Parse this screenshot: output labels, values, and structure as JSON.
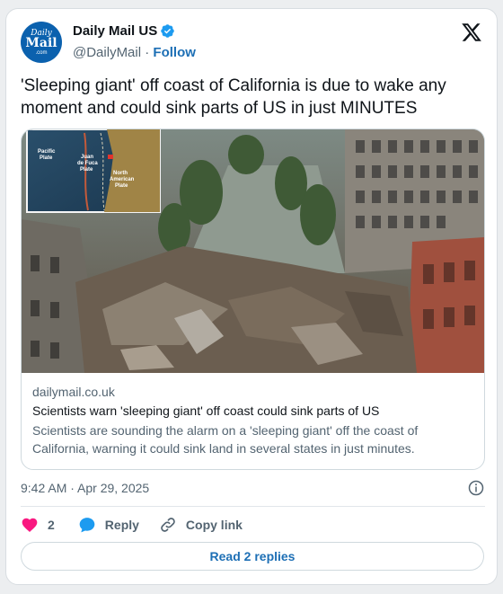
{
  "author": {
    "avatar": {
      "line1": "Daily",
      "line2": "Mail",
      "line3": ".com"
    },
    "name": "Daily Mail US",
    "handle": "@DailyMail",
    "separator": "·",
    "follow_label": "Follow"
  },
  "tweet": {
    "text": "'Sleeping giant' off coast of California is due to wake any moment and could sink parts of US in just MINUTES"
  },
  "card": {
    "inset_map_labels": {
      "pacific": [
        "Pacific",
        "Plate"
      ],
      "juan": [
        "Juan",
        "de Fuca",
        "Plate"
      ],
      "north_american": [
        "North",
        "American",
        "Plate"
      ]
    },
    "domain": "dailymail.co.uk",
    "title": "Scientists warn 'sleeping giant' off coast could sink parts of US",
    "description": "Scientists are sounding the alarm on a 'sleeping giant' off the coast of California, warning it could sink land in several states in just minutes."
  },
  "meta": {
    "timestamp": "9:42 AM · Apr 29, 2025"
  },
  "actions": {
    "likes_count": "2",
    "reply_label": "Reply",
    "copy_link_label": "Copy link"
  },
  "read_replies_label": "Read 2 replies",
  "colors": {
    "like": "#f91880",
    "reply": "#1d9bf0",
    "verified": "#1d9bf0",
    "link": "#1d6fb5"
  },
  "icons": [
    "verified-badge-icon",
    "x-logo-icon",
    "info-icon",
    "heart-icon",
    "reply-bubble-icon",
    "link-icon"
  ]
}
